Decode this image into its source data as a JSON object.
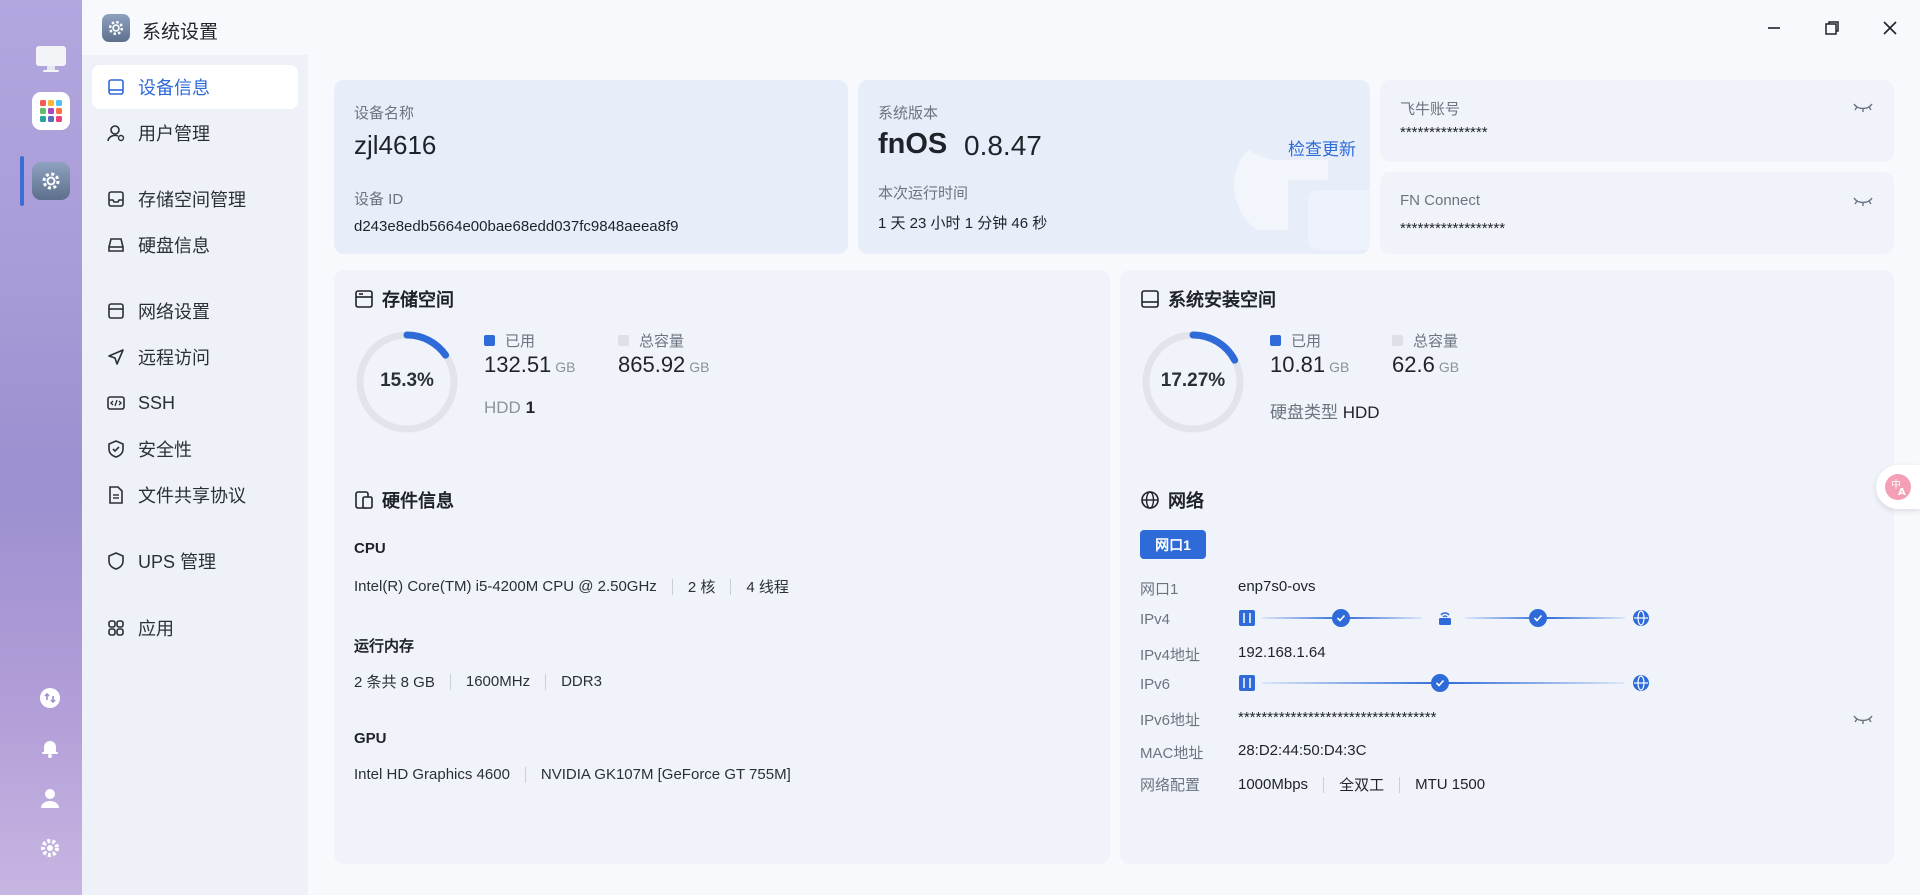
{
  "window": {
    "title": "系统设置"
  },
  "sidebar": {
    "items": [
      {
        "label": "设备信息"
      },
      {
        "label": "用户管理"
      },
      {
        "label": "存储空间管理"
      },
      {
        "label": "硬盘信息"
      },
      {
        "label": "网络设置"
      },
      {
        "label": "远程访问"
      },
      {
        "label": "SSH"
      },
      {
        "label": "安全性"
      },
      {
        "label": "文件共享协议"
      },
      {
        "label": "UPS 管理"
      },
      {
        "label": "应用"
      }
    ]
  },
  "device": {
    "name_label": "设备名称",
    "name": "zjl4616",
    "id_label": "设备 ID",
    "id": "d243e8edb5664e00bae68edd037fc9848aeea8f9"
  },
  "system": {
    "version_label": "系统版本",
    "os": "fnOS",
    "version": "0.8.47",
    "check_update": "检查更新",
    "uptime_label": "本次运行时间",
    "uptime": "1 天 23 小时 1 分钟 46 秒"
  },
  "account": {
    "label": "飞牛账号",
    "value": "***************"
  },
  "fnconnect": {
    "label": "FN Connect",
    "value": "******************"
  },
  "storage": {
    "title": "存储空间",
    "percent": "15.3%",
    "percent_value": 15.3,
    "used_label": "已用",
    "used": "132.51",
    "used_unit": "GB",
    "total_label": "总容量",
    "total": "865.92",
    "total_unit": "GB",
    "disk_type": "HDD",
    "disk_count": "1"
  },
  "sysinstall": {
    "title": "系统安装空间",
    "percent": "17.27%",
    "percent_value": 17.27,
    "used_label": "已用",
    "used": "10.81",
    "used_unit": "GB",
    "total_label": "总容量",
    "total": "62.6",
    "total_unit": "GB",
    "disk_type_label": "硬盘类型",
    "disk_type": "HDD"
  },
  "hardware": {
    "title": "硬件信息",
    "cpu_label": "CPU",
    "cpu_model": "Intel(R) Core(TM) i5-4200M CPU @ 2.50GHz",
    "cpu_cores": "2 核",
    "cpu_threads": "4 线程",
    "mem_label": "运行内存",
    "mem_size": "2 条共 8 GB",
    "mem_freq": "1600MHz",
    "mem_type": "DDR3",
    "gpu_label": "GPU",
    "gpu1": "Intel HD Graphics 4600",
    "gpu2": "NVIDIA GK107M [GeForce GT 755M]"
  },
  "network": {
    "title": "网络",
    "tab": "网口1",
    "iface_key": "网口1",
    "iface_val": "enp7s0-ovs",
    "ipv4_key": "IPv4",
    "ipv4addr_key": "IPv4地址",
    "ipv4addr_val": "192.168.1.64",
    "ipv6_key": "IPv6",
    "ipv6addr_key": "IPv6地址",
    "ipv6addr_val": "**********************************",
    "mac_key": "MAC地址",
    "mac_val": "28:D2:44:50:D4:3C",
    "config_key": "网络配置",
    "speed": "1000Mbps",
    "duplex": "全双工",
    "mtu": "MTU 1500"
  },
  "colors": {
    "accent": "#2f6bd8",
    "ring_track": "#e1e5eb",
    "card": "#f0f4fa"
  }
}
